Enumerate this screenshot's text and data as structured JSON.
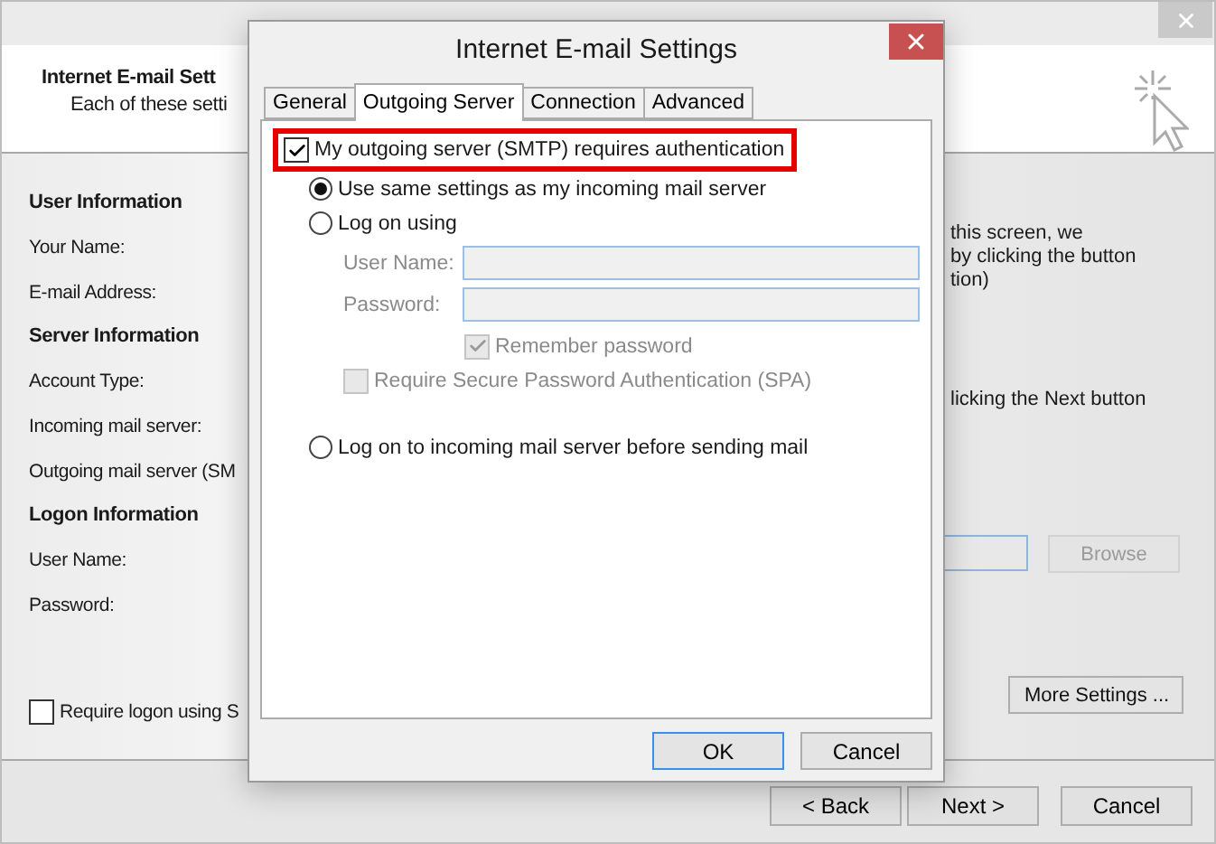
{
  "background_window": {
    "header": {
      "title": "Internet E-mail Sett",
      "subtitle": "Each of these setti"
    },
    "sections": [
      {
        "heading": "User Information",
        "labels": [
          "Your Name:",
          "E-mail Address:"
        ]
      },
      {
        "heading": "Server Information",
        "labels": [
          "Account Type:",
          "Incoming mail server:",
          "Outgoing mail server (SM"
        ]
      },
      {
        "heading": "Logon Information",
        "labels": [
          "User Name:",
          "Password:"
        ]
      }
    ],
    "logon_checkbox": {
      "label": "Require logon using S",
      "checked": false
    },
    "side_text": [
      "this screen, we",
      "by clicking the button",
      "tion)"
    ],
    "side_note": "licking the Next button",
    "browse_button": {
      "label": "Browse",
      "disabled": true
    },
    "more_settings_button": "More Settings ...",
    "buttons": [
      "< Back",
      "Next >",
      "Cancel"
    ]
  },
  "dialog": {
    "title": "Internet E-mail Settings",
    "tabs": [
      {
        "label": "General",
        "selected": false
      },
      {
        "label": "Outgoing Server",
        "selected": true
      },
      {
        "label": "Connection",
        "selected": false
      },
      {
        "label": "Advanced",
        "selected": false
      }
    ],
    "auth_checkbox": {
      "label": "My outgoing server (SMTP) requires authentication",
      "checked": true,
      "highlighted": true
    },
    "options": [
      {
        "kind": "radio",
        "label": "Use same settings as my incoming mail server",
        "selected": true
      },
      {
        "kind": "radio",
        "label": "Log on using",
        "selected": false
      },
      {
        "kind": "field",
        "label": "User Name:",
        "disabled": true
      },
      {
        "kind": "field",
        "label": "Password:",
        "disabled": true
      },
      {
        "kind": "checkbox",
        "label": "Remember password",
        "checked": true,
        "disabled": true
      },
      {
        "kind": "checkbox",
        "label": "Require Secure Password Authentication (SPA)",
        "checked": false,
        "disabled": true
      },
      {
        "kind": "radio",
        "label": "Log on to incoming mail server before sending mail",
        "selected": false
      }
    ],
    "buttons": [
      "OK",
      "Cancel"
    ]
  }
}
